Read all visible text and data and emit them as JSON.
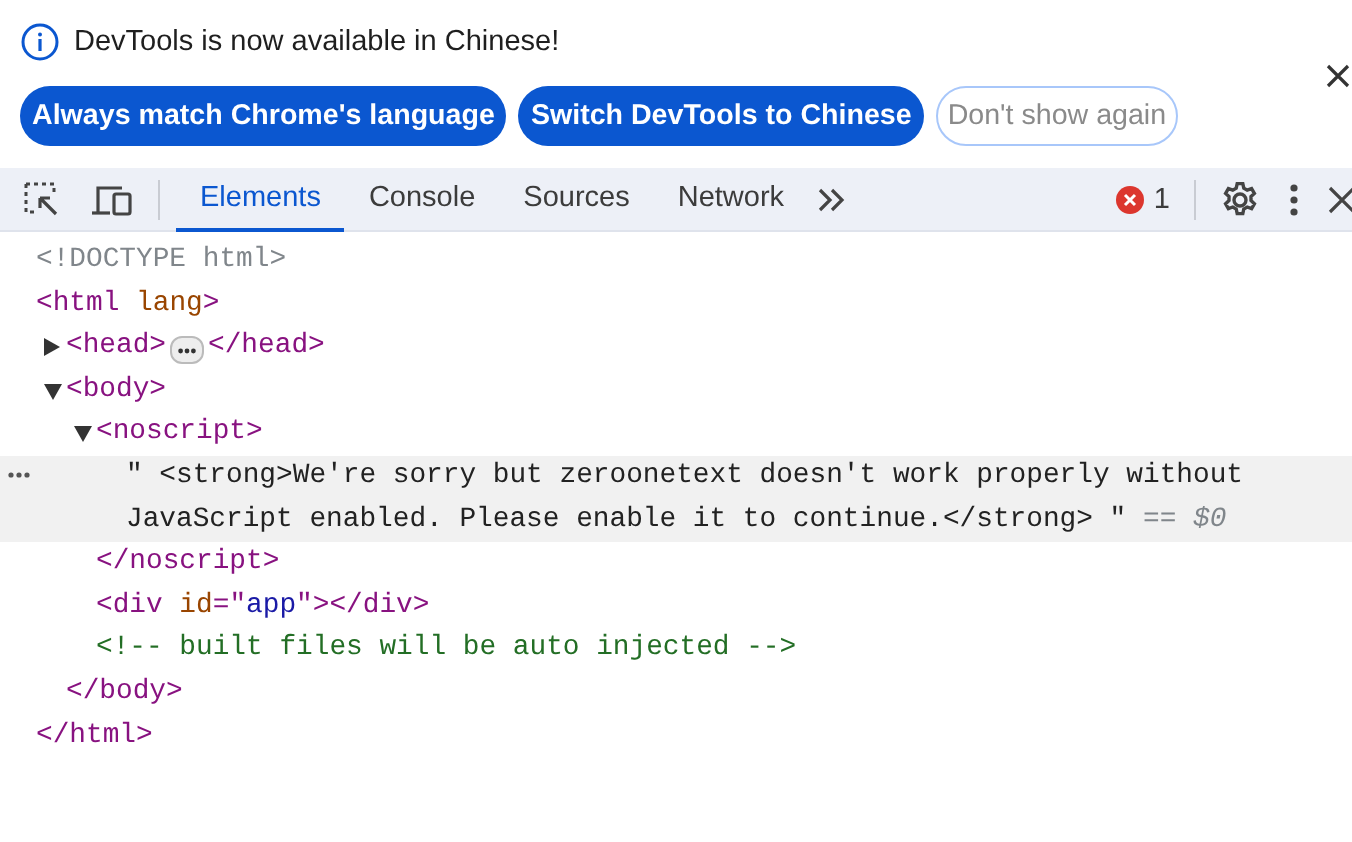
{
  "infobar": {
    "message": "DevTools is now available in Chinese!",
    "buttons": [
      {
        "label": "Always match Chrome's language",
        "kind": "primary"
      },
      {
        "label": "Switch DevTools to Chinese",
        "kind": "primary"
      },
      {
        "label": "Don't show again",
        "kind": "secondary"
      }
    ]
  },
  "toolbar": {
    "tabs": [
      {
        "label": "Elements",
        "selected": true
      },
      {
        "label": "Console",
        "selected": false
      },
      {
        "label": "Sources",
        "selected": false
      },
      {
        "label": "Network",
        "selected": false
      }
    ],
    "error_count": "1"
  },
  "tree": [
    {
      "selected": false,
      "open": [
        {
          "kind": "doctype",
          "text": "<!DOCTYPE html>"
        }
      ]
    },
    {
      "selected": false,
      "open": [
        {
          "kind": "tag",
          "text": "<html"
        },
        {
          "kind": "attr",
          "text": " lang"
        },
        {
          "kind": "tag",
          "text": ">"
        }
      ],
      "close": [
        {
          "kind": "tag",
          "text": "</html>"
        }
      ],
      "children": [
        {
          "selected": false,
          "expanded": false,
          "open": [
            {
              "kind": "tag",
              "text": "<head>"
            }
          ],
          "close": [
            {
              "kind": "tag",
              "text": "</head>"
            }
          ]
        },
        {
          "selected": false,
          "expanded": true,
          "open": [
            {
              "kind": "tag",
              "text": "<body>"
            }
          ],
          "close": [
            {
              "kind": "tag",
              "text": "</body>"
            }
          ],
          "children": [
            {
              "selected": false,
              "expanded": true,
              "open": [
                {
                  "kind": "tag",
                  "text": "<noscript>"
                }
              ],
              "close": [
                {
                  "kind": "tag",
                  "text": "</noscript>"
                }
              ],
              "children": [
                {
                  "selected": true,
                  "open": [
                    {
                      "kind": "text",
                      "text": "\" <strong>We're sorry but zeroonetext doesn't work properly without JavaScript enabled. Please enable it to continue.</strong> \""
                    }
                  ],
                  "marker": "== $0"
                }
              ]
            },
            {
              "selected": false,
              "open": [
                {
                  "kind": "tag",
                  "text": "<div"
                },
                {
                  "kind": "attr",
                  "text": " id"
                },
                {
                  "kind": "tag",
                  "text": "=\""
                },
                {
                  "kind": "value",
                  "text": "app"
                },
                {
                  "kind": "tag",
                  "text": "\"></div>"
                }
              ]
            },
            {
              "selected": false,
              "open": [
                {
                  "kind": "comment",
                  "text": "<!-- built files will be auto injected -->"
                }
              ]
            }
          ]
        }
      ]
    }
  ]
}
